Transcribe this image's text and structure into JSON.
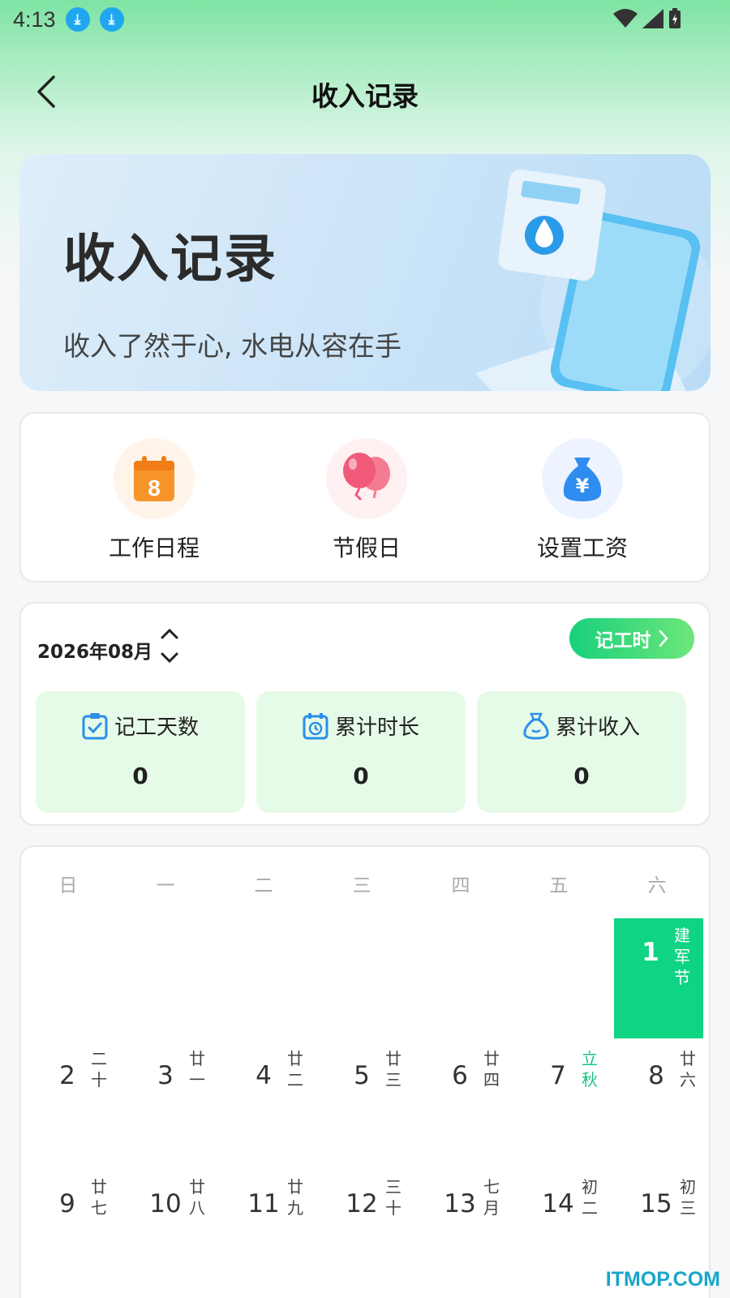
{
  "status_bar": {
    "time": "4:13"
  },
  "header": {
    "title": "收入记录"
  },
  "banner": {
    "title": "收入记录",
    "subtitle": "收入了然于心, 水电从容在手"
  },
  "features": [
    {
      "label": "工作日程",
      "icon": "calendar-icon",
      "badge": "8"
    },
    {
      "label": "节假日",
      "icon": "balloon-icon"
    },
    {
      "label": "设置工资",
      "icon": "money-bag-icon",
      "badge": "¥"
    }
  ],
  "stats": {
    "month": "2026年08月",
    "clock_button": "记工时",
    "items": [
      {
        "label": "记工天数",
        "value": "0",
        "icon": "checklist-icon"
      },
      {
        "label": "累计时长",
        "value": "0",
        "icon": "clock-calendar-icon"
      },
      {
        "label": "累计收入",
        "value": "0",
        "icon": "money-bag-icon"
      }
    ]
  },
  "calendar": {
    "weekdays": [
      "日",
      "一",
      "二",
      "三",
      "四",
      "五",
      "六"
    ],
    "days": [
      {
        "num": "1",
        "lunar": "建军节",
        "selected": true
      },
      {
        "num": "2",
        "lunar": "二十"
      },
      {
        "num": "3",
        "lunar": "廿一"
      },
      {
        "num": "4",
        "lunar": "廿二"
      },
      {
        "num": "5",
        "lunar": "廿三"
      },
      {
        "num": "6",
        "lunar": "廿四"
      },
      {
        "num": "7",
        "lunar": "立秋",
        "highlight": true
      },
      {
        "num": "8",
        "lunar": "廿六"
      },
      {
        "num": "9",
        "lunar": "廿七"
      },
      {
        "num": "10",
        "lunar": "廿八"
      },
      {
        "num": "11",
        "lunar": "廿九"
      },
      {
        "num": "12",
        "lunar": "三十"
      },
      {
        "num": "13",
        "lunar": "七月"
      },
      {
        "num": "14",
        "lunar": "初二"
      },
      {
        "num": "15",
        "lunar": "初三"
      }
    ]
  },
  "watermark": "ITMOP.COM",
  "colors": {
    "accent": "#0fd483",
    "stat_bg": "#e6fbe7",
    "calendar_orange": "#f7952b",
    "balloon_pink": "#f05a78",
    "bag_blue": "#2f8cf0"
  }
}
